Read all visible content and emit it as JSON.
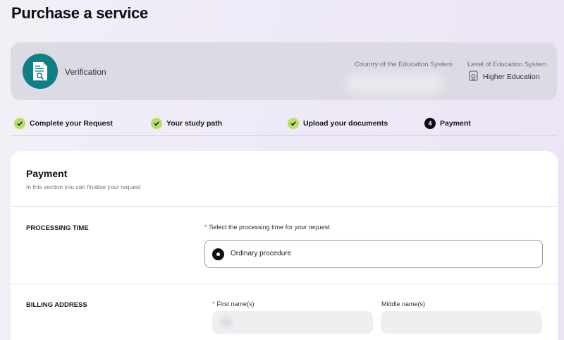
{
  "page": {
    "title": "Purchase a service"
  },
  "service": {
    "name": "Verification",
    "icon": "document-search-icon",
    "country_label": "Country of the Education System",
    "country_value": "",
    "level_label": "Level of Education System",
    "level_value": "Higher Education",
    "level_icon": "graduation-certificate-icon"
  },
  "steps": [
    {
      "label": "Complete your Request",
      "status": "done"
    },
    {
      "label": "Your study path",
      "status": "done"
    },
    {
      "label": "Upload your documents",
      "status": "done"
    },
    {
      "label": "Payment",
      "status": "current",
      "number": "4"
    }
  ],
  "payment": {
    "title": "Payment",
    "subtitle": "In this section you can finalise your request",
    "processing": {
      "label": "PROCESSING TIME",
      "required_mark": "*",
      "prompt": "Select the processing time for your request",
      "option": "Ordinary procedure"
    },
    "billing": {
      "label": "BILLING ADDRESS",
      "required_mark": "*",
      "first_name_label": "First name(s)",
      "first_name_value": "",
      "middle_name_label": "Middle name(s)",
      "middle_name_value": ""
    }
  },
  "colors": {
    "accent_teal": "#0f7f86",
    "step_done": "#b7df62",
    "required": "#d94a1e"
  }
}
